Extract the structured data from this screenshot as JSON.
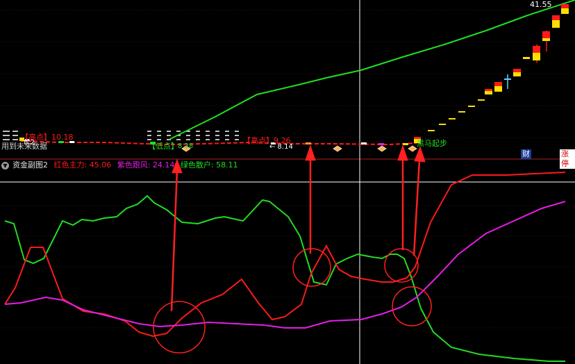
{
  "colors": {
    "bg": "#000000",
    "red": "#ff1a1a",
    "green": "#22dd22",
    "magenta": "#e61ee6",
    "white": "#ffffff",
    "grid": "#3a1414",
    "panel_border": "#b02020"
  },
  "main_panel": {
    "price_high_label": "41.55",
    "no_future_data_text": "用到未来数据",
    "high_mark_1": "【高点】10.18",
    "high_mark_2": "【高点】9.26",
    "low_mark": "【低点】",
    "low_value": "8.28",
    "price_left": "8.2",
    "price_arrow": "← 8.14",
    "signal_label": "黑马起步",
    "badge_finance": "财",
    "badge_limit": "涨停"
  },
  "sub_panel": {
    "collapse_icon": "chevron-down-icon",
    "indicator_name": "资金副图2",
    "legend": {
      "red": "红色主力: 45.06",
      "magenta": "紫色跟风: 24.14",
      "green": "绿色散户: 58.11"
    }
  }
}
